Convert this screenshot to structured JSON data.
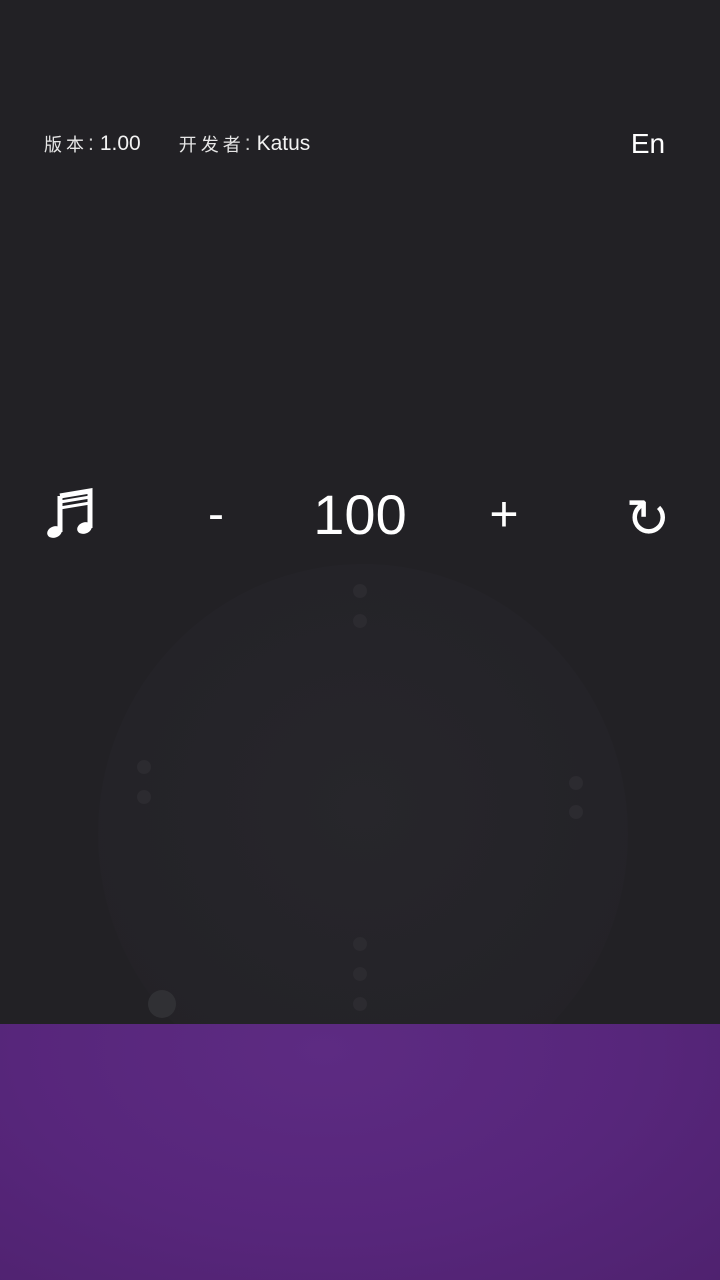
{
  "header": {
    "version_label": "版本",
    "version_value": "1.00",
    "developer_label": "开发者",
    "developer_value": "Katus",
    "separator": ":",
    "language_button": "En"
  },
  "counter": {
    "minus_label": "-",
    "value": "100",
    "plus_label": "+",
    "music_icon": "music-note-icon",
    "reset_icon": "reset-icon",
    "reset_glyph": "↻"
  },
  "colors": {
    "background": "#222125",
    "bottom_panel": "#5a2a7f",
    "text": "#ffffff"
  }
}
